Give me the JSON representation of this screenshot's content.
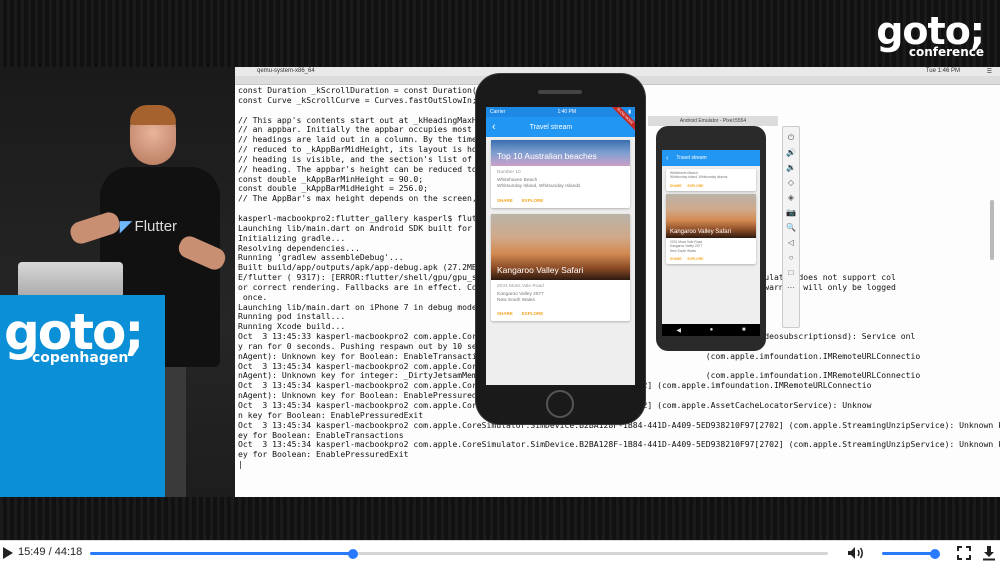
{
  "conference": {
    "logo_main": "goto;",
    "logo_sub": "conference",
    "podium_main": "goto;",
    "podium_sub": "copenhagen"
  },
  "speaker": {
    "shirt_text": "Flutter"
  },
  "desktop": {
    "window_title": "qemu-system-x86_64",
    "clock": "Tue 1:46 PM"
  },
  "terminal_lines": [
    "const Duration _kScrollDuration = const Duration(m",
    "const Curve _kScrollCurve = Curves.fastOutSlowIn;",
    "",
    "// This app's contents start out at _kHeadingMaxHe",
    "// an appbar. Initially the appbar occupies most",
    "// headings are laid out in a column. By the time",
    "// reduced to _kAppBarMidHeight, its layout is ho",
    "// heading is visible, and the section's list of",
    "// heading. The appbar's height can be reduced to",
    "const double _kAppBarMinHeight = 90.0;",
    "const double _kAppBarMidHeight = 256.0;",
    "// The AppBar's max height depends on the screen,",
    "",
    "kasperl-macbookpro2:flutter_gallery kasperl$ flutt",
    "Launching lib/main.dart on Android SDK built for x",
    "Initializing gradle...",
    "Resolving dependencies...",
    "Running 'gradlew assembleDebug'...",
    "Built build/app/outputs/apk/app-debug.apk (27.2MB)",
    "E/flutter ( 9317): [ERROR:flutter/shell/gpu/gpu_su                                              device or emulator does not support col",
    "or correct rendering. Fallbacks are in effect. Col                                              vices. This warning will only be logged",
    " once.",
    "Launching lib/main.dart on iPhone 7 in debug mode.",
    "Running pod install...",
    "Running Xcode build...",
    "Oct  3 13:45:33 kasperl-macbookpro2 com.apple.CoreS                                             com.apple.videosubscriptionsd): Service onl",
    "y ran for 0 seconds. Pushing respawn out by 10 sec",
    "nAgent): Unknown key for Boolean: EnableTransactio                                              (com.apple.imfoundation.IMRemoteURLConnectio",
    "Oct  3 13:45:34 kasperl-macbookpro2 com.apple.CoreS",
    "nAgent): Unknown key for integer: _DirtyJetsamMemo                                              (com.apple.imfoundation.IMRemoteURLConnectio",
    "Oct  3 13:45:34 kasperl-macbookpro2 com.apple.CoreS       41D-A409-5ED938210F97[2702] (com.apple.imfoundation.IMRemoteURLConnectio",
    "nAgent): Unknown key for Boolean: EnablePressuredE",
    "Oct  3 13:45:34 kasperl-macbookpro2 com.apple.CoreS       41D-A409-5ED938210F97[2702] (com.apple.AssetCacheLocatorService): Unknow",
    "n key for Boolean: EnablePressuredExit",
    "Oct  3 13:45:34 kasperl-macbookpro2 com.apple.CoreSimulator.SimDevice.B2BA128F-1B84-441D-A409-5ED938210F97[2702] (com.apple.StreamingUnzipService): Unknown k",
    "ey for Boolean: EnableTransactions",
    "Oct  3 13:45:34 kasperl-macbookpro2 com.apple.CoreSimulator.SimDevice.B2BA128F-1B84-441D-A409-5ED938210F97[2702] (com.apple.StreamingUnzipService): Unknown k",
    "ey for Boolean: EnablePressuredExit",
    "|"
  ],
  "ios_app": {
    "carrier": "Carrier",
    "time": "1:40 PM",
    "title": "Travel stream",
    "debug_banner": "SLOW MODE",
    "cards": [
      {
        "image_title": "Top 10 Australian beaches",
        "label": "Number 10",
        "line1": "Whitehaven Beach",
        "line2": "Whitsunday Island, Whitsunday Islands",
        "share": "SHARE",
        "explore": "EXPLORE"
      },
      {
        "image_title": "Kangaroo Valley Safari",
        "label": "2031 Moss Vale Road",
        "line1": "Kangaroo Valley 2577",
        "line2": "New South Wales",
        "share": "SHARE",
        "explore": "EXPLORE"
      }
    ]
  },
  "android_app": {
    "window_title": "Android Emulator - Pixel:5554",
    "title": "Travel stream",
    "cards": [
      {
        "line1": "Whitehaven Beach",
        "line2": "Whitsunday Island, Whitsunday Islands",
        "share": "SHARE",
        "explore": "EXPLORE"
      },
      {
        "image_title": "Kangaroo Valley Safari",
        "label": "2031 Moss Vale Road",
        "line1": "Kangaroo Valley 2577",
        "line2": "New South Wales",
        "share": "SHARE",
        "explore": "EXPLORE"
      }
    ],
    "nav": {
      "back": "◀",
      "home": "●",
      "recents": "■"
    }
  },
  "emulator_toolbar": [
    "⏻",
    "🔊",
    "🔉",
    "◇",
    "◈",
    "📷",
    "🔍",
    "◁",
    "○",
    "□",
    "⋯"
  ],
  "player": {
    "current_time": "15:49",
    "separator": "/",
    "duration": "44:18",
    "progress_fraction": 0.357,
    "volume_fraction": 0.95,
    "accent": "#2979ff",
    "icons": {
      "play": "play-icon",
      "volume": "volume-icon",
      "fullscreen": "fullscreen-icon",
      "download": "download-icon"
    }
  }
}
